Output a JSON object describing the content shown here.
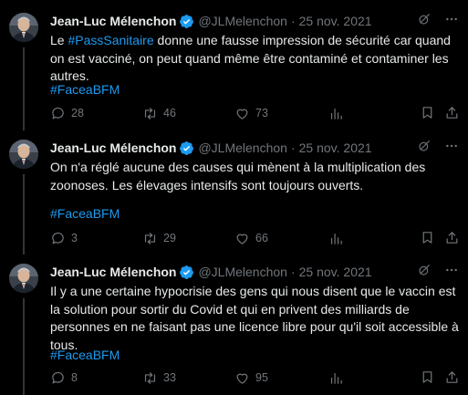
{
  "author": {
    "name": "Jean-Luc Mélenchon",
    "handle": "@JLMelenchon",
    "separator": "·",
    "avatar_icon": "avatar-photo",
    "verified_icon": "verified-badge-icon"
  },
  "colors": {
    "background": "#000000",
    "text": "#e7e9ea",
    "muted": "#71767b",
    "link": "#1d9bf0",
    "thread_line": "#333639"
  },
  "tweets": [
    {
      "date": "25 nov. 2021",
      "text_before": "Le ",
      "inline_hashtag": "#PassSanitaire",
      "text_after": " donne une fausse impression de sécurité car quand on est vacciné, on peut quand même être contaminé et contaminer les autres.",
      "hashtag": "#FaceaBFM",
      "replies": "28",
      "retweets": "46",
      "likes": "73"
    },
    {
      "date": "25 nov. 2021",
      "text_before": "On n'a réglé aucune des causes qui mènent à la multiplication des zoonoses. Les élevages intensifs sont toujours ouverts.",
      "hashtag": "#FaceaBFM",
      "replies": "3",
      "retweets": "29",
      "likes": "66"
    },
    {
      "date": "25 nov. 2021",
      "text_before": "Il y a une certaine hypocrisie des gens qui nous disent que le vaccin est la solution pour sortir du Covid et qui en privent des milliards de personnes en ne faisant pas une licence libre pour qu'il soit accessible à tous.",
      "hashtag": "#FaceaBFM",
      "replies": "8",
      "retweets": "33",
      "likes": "95"
    }
  ],
  "icons": {
    "reply": "reply-icon",
    "retweet": "retweet-icon",
    "like": "heart-icon",
    "views": "views-icon",
    "bookmark": "bookmark-icon",
    "share": "share-icon",
    "grok": "grok-icon",
    "more": "more-icon"
  }
}
